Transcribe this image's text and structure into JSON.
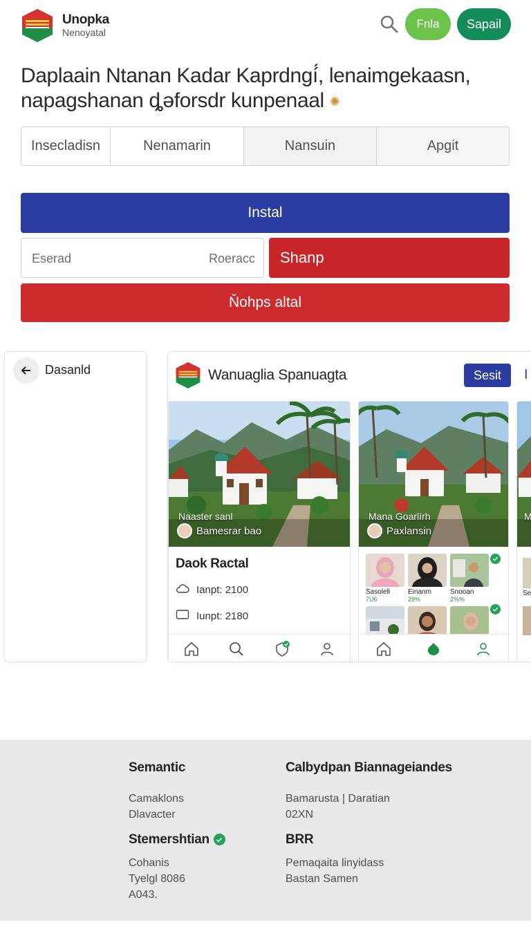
{
  "header": {
    "brand_name": "Unopka",
    "brand_sub": "Nenoyatal",
    "login_label": "Fnla",
    "signup_label": "Sapail"
  },
  "headline": "Daplaain Ntanan Kadar Kaprdngí́, lenaimgekaasn, napagshanan ȡəforsdr kunpenaal",
  "tabs": [
    "Insecladisn",
    "Nenamarin",
    "Nansuin",
    "Apgit"
  ],
  "actions": {
    "install_label": "Instal",
    "input_placeholder": "Eserad",
    "input_trailing": "Roeracc",
    "shanp_label": "Shanp",
    "wide_red_label": "Ňohps altal"
  },
  "left_panel": {
    "title": "Dasanld"
  },
  "mock": {
    "title": "Wanuaglia Spanuagta",
    "button_label": "Sesit",
    "edge_label": "I",
    "card1": {
      "caption1": "Naaster sanl",
      "caption2": "Bamesrar bao",
      "title": "Daok Ractal",
      "row1": "Ianpt: 2100",
      "row2": "Iunpt: 2180"
    },
    "card2": {
      "caption1": "Mana Goarlírh",
      "caption2": "Paxlansin",
      "people": [
        {
          "name": "Sasolell",
          "pct": "7U6"
        },
        {
          "name": "Einanm",
          "pct": "29%"
        },
        {
          "name": "Snooan",
          "pct": "2%%"
        }
      ]
    },
    "card3": {
      "caption": "M",
      "label": "Se"
    }
  },
  "footer": {
    "col1_title": "Semantic",
    "col1_lines": [
      "Camaklons",
      "Dlavacter"
    ],
    "col1_title2": "Stemershtian",
    "col1_lines2": [
      "Cohanis",
      "Tyelgl 8086",
      "A043."
    ],
    "col2_title": "Calbydpan Biannageiandes",
    "col2_lines": [
      "Bamarusta  |  Daratian",
      "02XN"
    ],
    "col2_title2": "BRR",
    "col2_lines2": [
      "Pemaqaita linyidass",
      "Bastan Samen"
    ]
  },
  "colors": {
    "green_light": "#6cc24a",
    "green_dark": "#138c5a",
    "navy": "#2b3da3",
    "red": "#c8252b"
  }
}
